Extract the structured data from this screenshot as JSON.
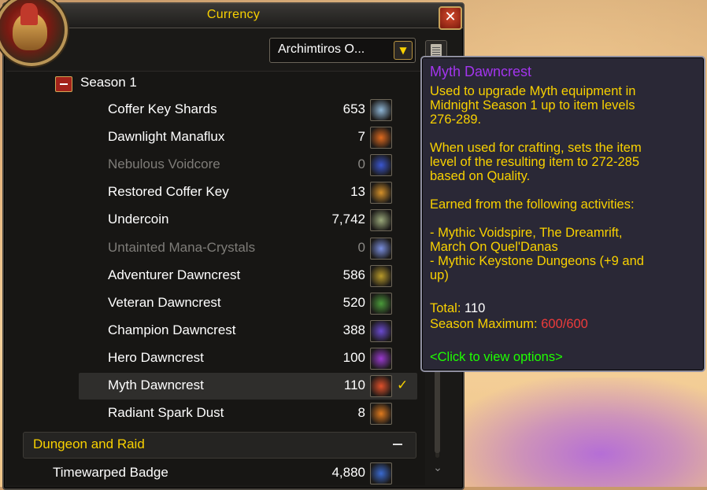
{
  "window": {
    "title": "Currency",
    "close_label": "✕",
    "dropdown_value": "Archimtiros O...",
    "dropdown_arrow": "▼"
  },
  "season": {
    "label": "Season 1",
    "items": [
      {
        "name": "Coffer Key Shards",
        "count": "653",
        "icon": "coffer-key-shards-icon",
        "color": "#8fb6d6",
        "dim": false
      },
      {
        "name": "Dawnlight Manaflux",
        "count": "7",
        "icon": "manaflux-icon",
        "color": "#e06a1e",
        "dim": false
      },
      {
        "name": "Nebulous Voidcore",
        "count": "0",
        "icon": "voidcore-icon",
        "color": "#3a56d0",
        "dim": true
      },
      {
        "name": "Restored Coffer Key",
        "count": "13",
        "icon": "coffer-key-icon",
        "color": "#d4902a",
        "dim": false
      },
      {
        "name": "Undercoin",
        "count": "7,742",
        "icon": "undercoin-icon",
        "color": "#9aa87a",
        "dim": false
      },
      {
        "name": "Untainted Mana-Crystals",
        "count": "0",
        "icon": "mana-crystals-icon",
        "color": "#7a8fe0",
        "dim": true
      },
      {
        "name": "Adventurer Dawncrest",
        "count": "586",
        "icon": "adventurer-dawncrest-icon",
        "color": "#b89a2a",
        "dim": false
      },
      {
        "name": "Veteran Dawncrest",
        "count": "520",
        "icon": "veteran-dawncrest-icon",
        "color": "#4a9a3a",
        "dim": false
      },
      {
        "name": "Champion Dawncrest",
        "count": "388",
        "icon": "champion-dawncrest-icon",
        "color": "#6a4ad0",
        "dim": false
      },
      {
        "name": "Hero Dawncrest",
        "count": "100",
        "icon": "hero-dawncrest-icon",
        "color": "#9a3ad0",
        "dim": false
      },
      {
        "name": "Myth Dawncrest",
        "count": "110",
        "icon": "myth-dawncrest-icon",
        "color": "#e0502a",
        "dim": false,
        "selected": true,
        "check": "✓"
      },
      {
        "name": "Radiant Spark Dust",
        "count": "8",
        "icon": "spark-dust-icon",
        "color": "#e07a1e",
        "dim": false
      }
    ]
  },
  "category": {
    "label": "Dungeon and Raid"
  },
  "lower_items": [
    {
      "name": "Timewarped Badge",
      "count": "4,880",
      "icon": "timewarped-badge-icon",
      "color": "#3a6ad0"
    }
  ],
  "tooltip": {
    "title": "Myth Dawncrest",
    "desc1": "Used to upgrade Myth equipment in\nMidnight Season 1 up to item levels\n276-289.",
    "desc2": "When used for crafting, sets the item\nlevel of the resulting item to 272-285\nbased on Quality.",
    "earned_header": "Earned from the following activities:",
    "activities": "- Mythic Voidspire, The Dreamrift,\nMarch On Quel'Danas\n- Mythic Keystone Dungeons (+9 and\nup)",
    "total_label": "Total: ",
    "total_value": "110",
    "season_max_label": "Season Maximum: ",
    "season_max_value": "600/600",
    "click_hint": "<Click to view options>"
  }
}
